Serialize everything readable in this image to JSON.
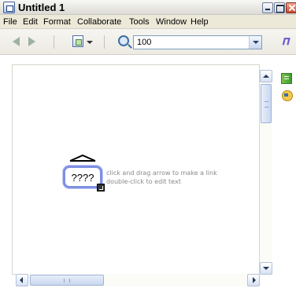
{
  "window": {
    "title": "Untitled 1"
  },
  "menu": [
    "File",
    "Edit",
    "Format",
    "Collaborate",
    "Tools",
    "Window",
    "Help"
  ],
  "toolbar": {
    "zoom_value": "100"
  },
  "topic": {
    "text": "????"
  },
  "hints": {
    "line1": "click and drag arrow to make a link",
    "line2": "double-click to edit text"
  },
  "icons": {
    "app": "app-icon",
    "back": "back-arrow-icon",
    "forward": "forward-arrow-icon",
    "view": "view-mode-icon",
    "zoom": "zoom-icon",
    "tools": "tools-icon",
    "notes": "notes-icon",
    "people": "people-icon"
  }
}
